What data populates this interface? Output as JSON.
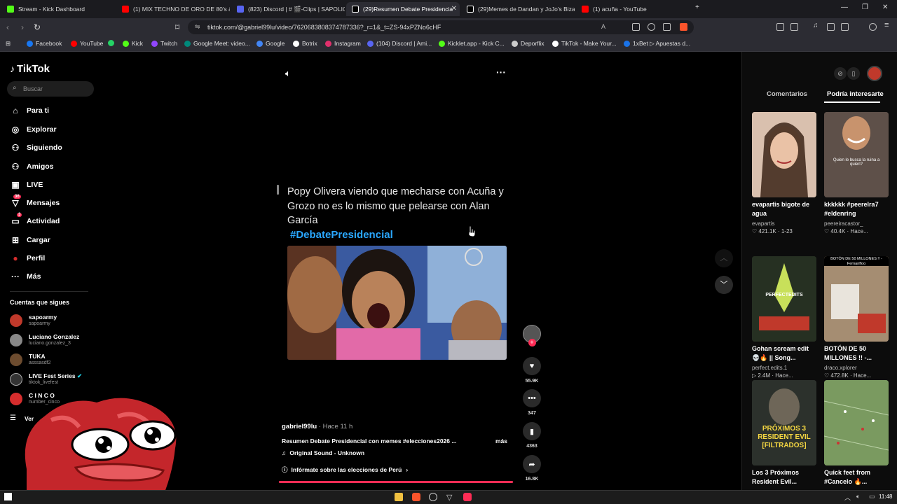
{
  "tabs": [
    {
      "title": "Stream - Kick Dashboard",
      "color": "#53fc18"
    },
    {
      "title": "(1) MIX TECHNO DE ORO DE 80's &",
      "color": "#ff0000"
    },
    {
      "title": "(823) Discord | # 🎬-Clips | SAPOLIOS",
      "color": "#5865f2"
    },
    {
      "title": "(29)Resumen Debate Presidencia",
      "color": "#000000"
    },
    {
      "title": "(29)Memes de Dandan y JoJo's Bizar",
      "color": "#000000"
    },
    {
      "title": "(1) acuña - YouTube",
      "color": "#ff0000"
    }
  ],
  "address": {
    "url": "tiktok.com/@gabriel99lu/video/7620683808374787336?_r=1&_t=ZS-94xPZNo6cHF"
  },
  "bookmarks": [
    {
      "label": "Facebook",
      "color": "#1877f2"
    },
    {
      "label": "YouTube",
      "color": "#ff0000"
    },
    {
      "label": "",
      "color": "#25d366"
    },
    {
      "label": "Kick",
      "color": "#53fc18"
    },
    {
      "label": "Twitch",
      "color": "#9146ff"
    },
    {
      "label": "Google Meet: video...",
      "color": "#00897b"
    },
    {
      "label": "Google",
      "color": "#4285f4"
    },
    {
      "label": "Botrix",
      "color": "#ffffff"
    },
    {
      "label": "Instagram",
      "color": "#e1306c"
    },
    {
      "label": "(104) Discord | Ami...",
      "color": "#5865f2"
    },
    {
      "label": "Kicklet.app - Kick C...",
      "color": "#53fc18"
    },
    {
      "label": "Deporflix",
      "color": "#cccccc"
    },
    {
      "label": "TikTok - Make Your...",
      "color": "#ffffff"
    },
    {
      "label": "1xBet ▷ Apuestas d...",
      "color": "#1a73e8"
    }
  ],
  "sidebar": {
    "logo": "TikTok",
    "search_placeholder": "Buscar",
    "nav": [
      {
        "label": "Para ti",
        "icon": "⌂"
      },
      {
        "label": "Explorar",
        "icon": "◎"
      },
      {
        "label": "Siguiendo",
        "icon": "⚇"
      },
      {
        "label": "Amigos",
        "icon": "⚇"
      },
      {
        "label": "LIVE",
        "icon": "▣"
      },
      {
        "label": "Mensajes",
        "icon": "▽",
        "badge": "36"
      },
      {
        "label": "Actividad",
        "icon": "▭",
        "badge": "3"
      },
      {
        "label": "Cargar",
        "icon": "⊞"
      },
      {
        "label": "Perfil",
        "icon": "●"
      },
      {
        "label": "Más",
        "icon": "···"
      }
    ],
    "following_title": "Cuentas que sigues",
    "accounts": [
      {
        "name": "sapoarmy",
        "handle": "sapoarmy",
        "color": "#c0392b"
      },
      {
        "name": "Luciano Gonzalez",
        "handle": "luciano.gonzalez_3",
        "color": "#888888"
      },
      {
        "name": "TUKA",
        "handle": "asssasdf2",
        "color": "#6d4c2f"
      },
      {
        "name": "LIVE Fest Series",
        "handle": "tiktok_livefest",
        "color": "#333333",
        "verified": true
      },
      {
        "name": "C I N C O",
        "handle": "number_cinco",
        "color": "#d62d2d"
      }
    ],
    "see_more": "Ver"
  },
  "video": {
    "caption": "Popy Olivera viendo que mecharse con Acuña y Grozo no es lo mismo que pelearse con Alan García",
    "hashtag": "#DebatePresidencial",
    "author": "gabriel99lu",
    "time": "Hace 11 h",
    "description": "Resumen Debate Presidencial con memes #elecciones2026 ...",
    "more": "más",
    "sound": "Original Sound - Unknown",
    "info": "Infórmate sobre las elecciones de Perú",
    "likes": "55.9K",
    "comments": "347",
    "saves": "4363",
    "shares": "16.8K"
  },
  "right_panel": {
    "tab_comments": "Comentarios",
    "tab_suggested": "Podría interesarte",
    "cards": [
      {
        "title": "evapartis bigote de agua",
        "user": "evapartis",
        "stats": "♡ 421.1K · 1-23",
        "thumb_text": "",
        "bg": "#c9a68e"
      },
      {
        "title": "kkkkkk #peerelra7 #eldenring",
        "user": "peereiracastor_",
        "stats": "♡ 40.4K · Hace...",
        "thumb_text": "Quien le busca la ruina a quien?",
        "bg": "#6b5a52"
      },
      {
        "title": "Gohan scream edit 💀🔥 || Song...",
        "user": "perfect.edits.1",
        "stats": "▷ 2.4M · Hace...",
        "thumb_text": "PERFECTEDITS",
        "bg": "#2f3b2a"
      },
      {
        "title": "BOTÓN DE 50 MILLONES !! -...",
        "user": "draco.xplorer",
        "stats": "♡ 472.8K · Hace...",
        "thumb_text": "BOTÓN DE 50 MILLONES !! - Fernanfloo",
        "bg": "#b39a7e"
      },
      {
        "title": "Los 3 Próximos Resident Evil...",
        "user": "",
        "stats": "",
        "thumb_text": "PRÓXIMOS 3 RESIDENT EVIL [FILTRADOS]",
        "bg": "#3a3f3a"
      },
      {
        "title": "Quick feet from #Cancelo 🔥...",
        "user": "",
        "stats": "",
        "thumb_text": "",
        "bg": "#6f8b58"
      }
    ]
  },
  "taskbar": {
    "time": "11:48"
  }
}
